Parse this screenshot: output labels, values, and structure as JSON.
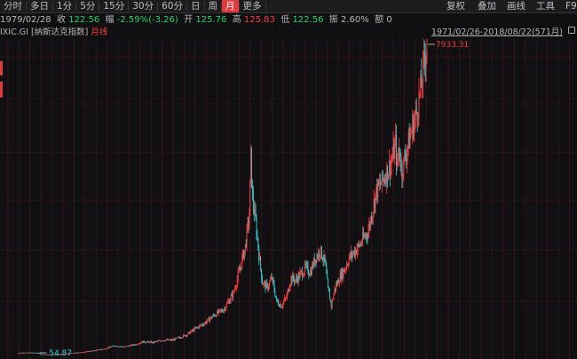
{
  "toolbar": {
    "periods": [
      "分时",
      "多日",
      "1分",
      "5分",
      "15分",
      "30分",
      "60分",
      "日",
      "周",
      "月",
      "更多"
    ],
    "active_period_index": 9,
    "right_buttons": [
      "复权",
      "叠加",
      "画线",
      "工具",
      "F9"
    ]
  },
  "info": {
    "date": "1979/02/28",
    "close_label": "收",
    "close_value": "122.56",
    "change_label": "幅",
    "change_value": "-2.59%(-3.26)",
    "open_label": "开",
    "open_value": "125.76",
    "high_label": "高",
    "high_value": "125.83",
    "low_label": "低",
    "low_value": "122.56",
    "amplitude_label": "振",
    "amplitude_value": "2.60%",
    "amount_label": "额",
    "amount_value": "0"
  },
  "chart_header": {
    "symbol": "IXIC.GI",
    "name": "[纳斯达克指数]",
    "period": "月线",
    "range": "1971/02/26-2018/08/22(571月)"
  },
  "chart_data": {
    "type": "candlestick",
    "max_label": "7933.31",
    "min_label": "54.87",
    "x_range": [
      "1971/02/26",
      "2018/08/22"
    ],
    "y_range": [
      54.87,
      7933.31
    ],
    "colors": {
      "up": "#ff3b3b",
      "down": "#33c8cc",
      "grid": "#7a2222",
      "background": "#101012"
    },
    "series_anchor_points": [
      [
        0,
        100
      ],
      [
        12,
        102
      ],
      [
        24,
        98
      ],
      [
        30,
        65
      ],
      [
        40,
        55
      ],
      [
        50,
        60
      ],
      [
        60,
        78
      ],
      [
        72,
        100
      ],
      [
        84,
        125
      ],
      [
        96,
        160
      ],
      [
        108,
        200
      ],
      [
        120,
        280
      ],
      [
        132,
        250
      ],
      [
        144,
        300
      ],
      [
        156,
        380
      ],
      [
        168,
        360
      ],
      [
        180,
        420
      ],
      [
        192,
        420
      ],
      [
        200,
        480
      ],
      [
        210,
        560
      ],
      [
        220,
        700
      ],
      [
        232,
        850
      ],
      [
        244,
        1050
      ],
      [
        256,
        1200
      ],
      [
        268,
        1600
      ],
      [
        276,
        2200
      ],
      [
        283,
        2800
      ],
      [
        288,
        3600
      ],
      [
        290,
        5050
      ],
      [
        292,
        4000
      ],
      [
        296,
        3400
      ],
      [
        300,
        2600
      ],
      [
        304,
        1900
      ],
      [
        310,
        1750
      ],
      [
        316,
        2000
      ],
      [
        322,
        1400
      ],
      [
        328,
        1300
      ],
      [
        334,
        1500
      ],
      [
        340,
        2000
      ],
      [
        346,
        1950
      ],
      [
        352,
        2100
      ],
      [
        358,
        2250
      ],
      [
        364,
        2150
      ],
      [
        370,
        2500
      ],
      [
        376,
        2700
      ],
      [
        382,
        2400
      ],
      [
        386,
        1700
      ],
      [
        390,
        1300
      ],
      [
        394,
        1700
      ],
      [
        400,
        2000
      ],
      [
        406,
        2200
      ],
      [
        412,
        2500
      ],
      [
        418,
        2650
      ],
      [
        424,
        2800
      ],
      [
        430,
        3000
      ],
      [
        436,
        3200
      ],
      [
        440,
        3600
      ],
      [
        446,
        4200
      ],
      [
        452,
        4400
      ],
      [
        458,
        4650
      ],
      [
        464,
        4900
      ],
      [
        470,
        5400
      ],
      [
        472,
        4800
      ],
      [
        474,
        5300
      ],
      [
        478,
        4700
      ],
      [
        482,
        5100
      ],
      [
        488,
        5600
      ],
      [
        496,
        6200
      ],
      [
        502,
        6900
      ],
      [
        506,
        7600
      ],
      [
        509,
        7933.31
      ]
    ]
  }
}
